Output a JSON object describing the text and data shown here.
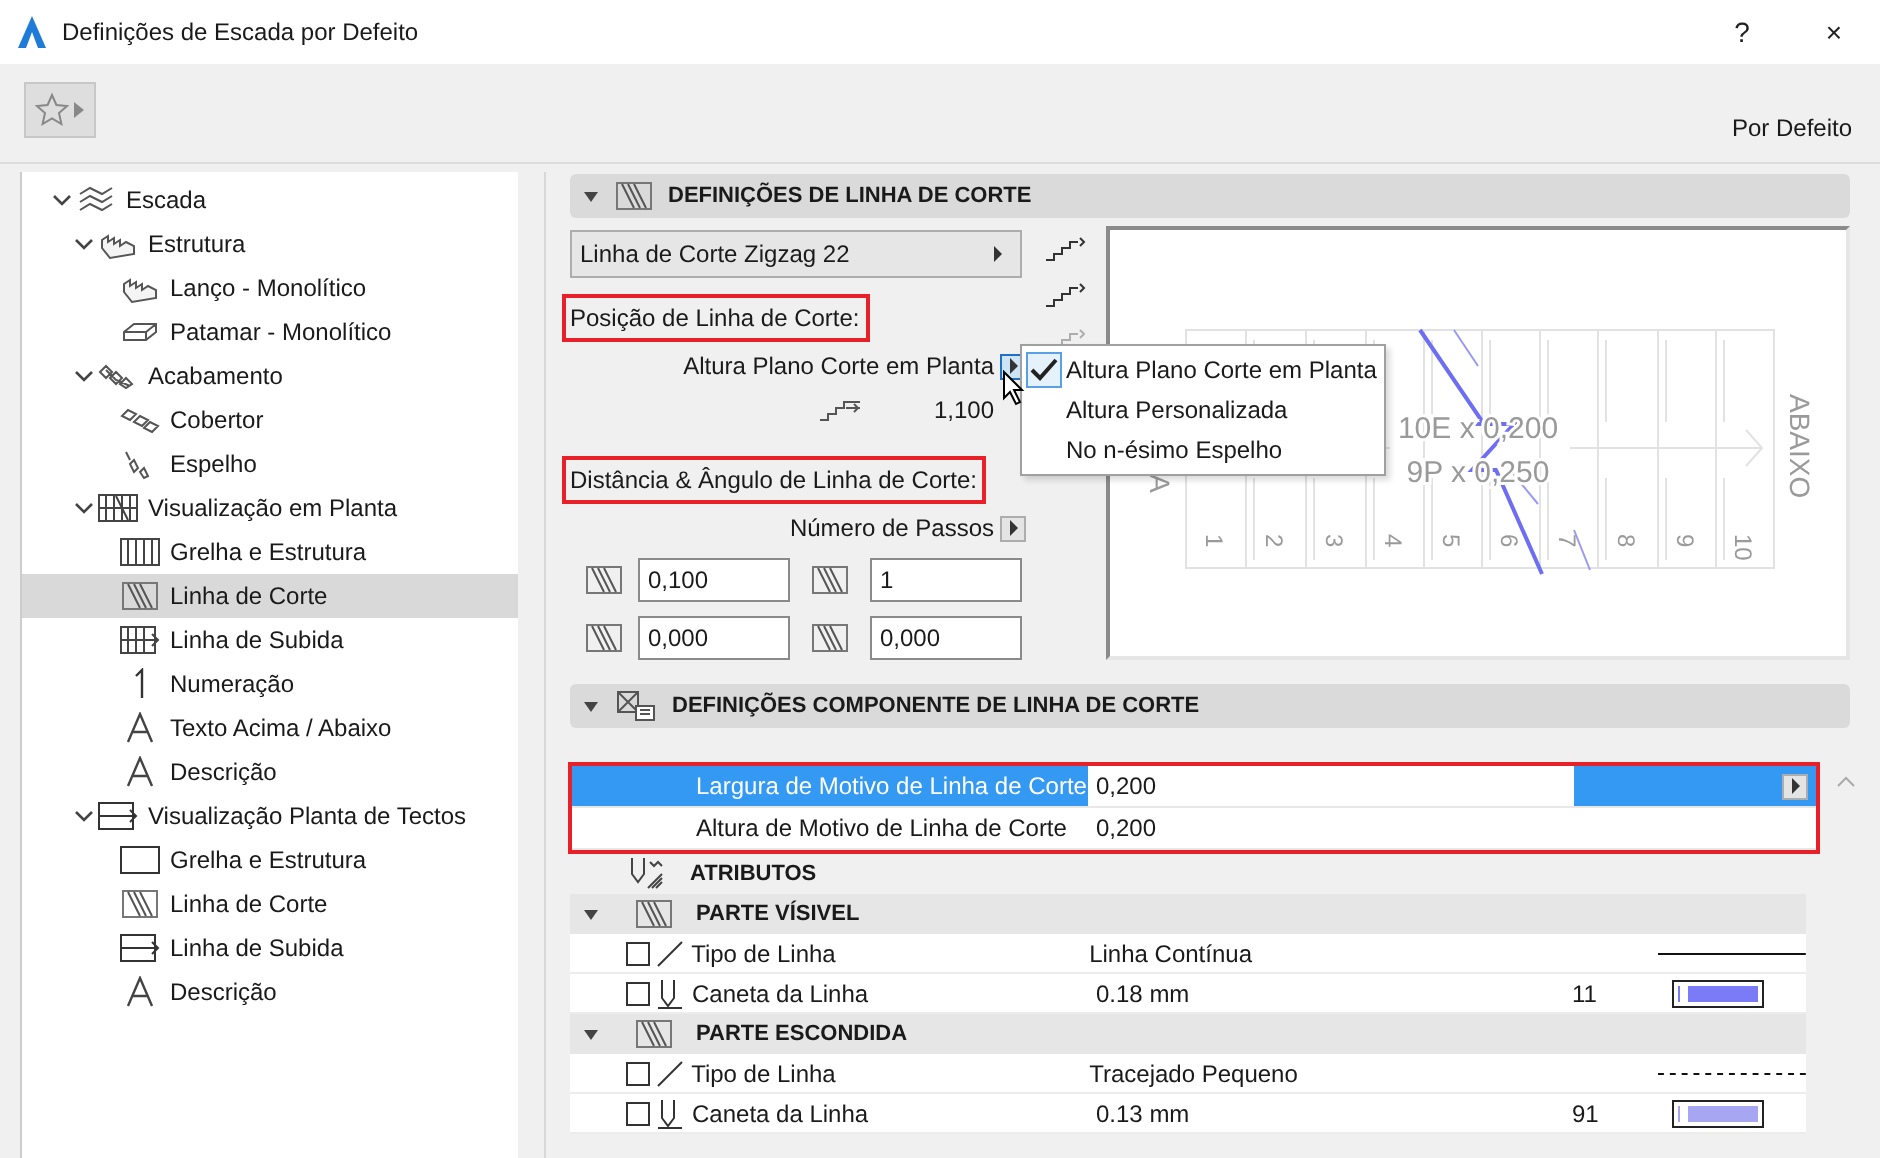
{
  "window": {
    "title": "Definições de Escada por Defeito",
    "help_button": "?",
    "close_button": "×"
  },
  "toolbar": {
    "preset_label": "Por Defeito"
  },
  "tree": [
    {
      "label": "Escada",
      "expanded": true,
      "selected": false,
      "children": [
        {
          "label": "Estrutura",
          "expanded": true,
          "selected": false,
          "children": [
            {
              "label": "Lanço - Monolítico",
              "selected": false
            },
            {
              "label": "Patamar - Monolítico",
              "selected": false
            }
          ]
        },
        {
          "label": "Acabamento",
          "expanded": true,
          "selected": false,
          "children": [
            {
              "label": "Cobertor",
              "selected": false
            },
            {
              "label": "Espelho",
              "selected": false
            }
          ]
        },
        {
          "label": "Visualização em Planta",
          "expanded": true,
          "selected": false,
          "children": [
            {
              "label": "Grelha e Estrutura",
              "selected": false
            },
            {
              "label": "Linha de Corte",
              "selected": true
            },
            {
              "label": "Linha de Subida",
              "selected": false
            },
            {
              "label": "Numeração",
              "selected": false
            },
            {
              "label": "Texto Acima / Abaixo",
              "selected": false
            },
            {
              "label": "Descrição",
              "selected": false
            }
          ]
        },
        {
          "label": "Visualização Planta de Tectos",
          "expanded": true,
          "selected": false,
          "children": [
            {
              "label": "Grelha e Estrutura",
              "selected": false
            },
            {
              "label": "Linha de Corte",
              "selected": false
            },
            {
              "label": "Linha de Subida",
              "selected": false
            },
            {
              "label": "Descrição",
              "selected": false
            }
          ]
        }
      ]
    }
  ],
  "cut_line_settings": {
    "title": "DEFINIÇÕES DE LINHA DE CORTE",
    "expanded": true,
    "style_dropdown": "Linha de Corte Zigzag 22",
    "position_label": {
      "text": "Posição de Linha de Corte:",
      "highlighted": true
    },
    "position_mode": "Altura Plano Corte em Planta",
    "height_value": "1,100",
    "distance_label": {
      "text": "Distância & Ângulo de Linha de Corte:",
      "highlighted": true
    },
    "steps_mode": "Número de Passos",
    "fields": [
      {
        "value": "0,100"
      },
      {
        "value": "1"
      },
      {
        "value": "0,000"
      },
      {
        "value": "0,000"
      }
    ],
    "line_end_options": [
      {
        "disabled": false
      },
      {
        "disabled": false
      },
      {
        "disabled": true
      }
    ],
    "preview": {
      "size_labels": [
        "10E x 0,200",
        "9P x 0,250"
      ],
      "direction_label": "ABAIXO",
      "start_label": "A",
      "step_numbers": [
        "1",
        "2",
        "3",
        "4",
        "5",
        "6",
        "7",
        "8",
        "9",
        "10"
      ]
    },
    "menu": [
      {
        "label": "Altura Plano Corte em Planta",
        "selected": true
      },
      {
        "label": "Altura Personalizada",
        "selected": false
      },
      {
        "label": "No n-ésimo Espelho",
        "selected": false
      }
    ]
  },
  "component_settings": {
    "title": "DEFINIÇÕES COMPONENTE DE LINHA DE CORTE",
    "expanded": true,
    "pattern_rows": {
      "highlighted": true,
      "rows": [
        {
          "label": "Largura de Motivo de Linha de Corte",
          "value": "0,200",
          "selected": true
        },
        {
          "label": "Altura de Motivo de Linha de Corte",
          "value": "0,200",
          "selected": false
        }
      ]
    },
    "attributes_title": "ATRIBUTOS",
    "groups": [
      {
        "title": "PARTE VÍSIVEL",
        "expanded": true,
        "rows": [
          {
            "kind": "line_type",
            "label": "Tipo de Linha",
            "value": "Linha Contínua",
            "checked": false,
            "dashed": false
          },
          {
            "kind": "pen",
            "label": "Caneta da Linha",
            "value": "0.18 mm",
            "checked": false,
            "pen_number": "11",
            "color": "#7b7bf7"
          }
        ]
      },
      {
        "title": "PARTE ESCONDIDA",
        "expanded": true,
        "rows": [
          {
            "kind": "line_type",
            "label": "Tipo de Linha",
            "value": "Tracejado Pequeno",
            "checked": false,
            "dashed": true
          },
          {
            "kind": "pen",
            "label": "Caneta da Linha",
            "value": "0.13 mm",
            "checked": false,
            "pen_number": "91",
            "color": "#a6a6f2"
          }
        ]
      }
    ]
  }
}
